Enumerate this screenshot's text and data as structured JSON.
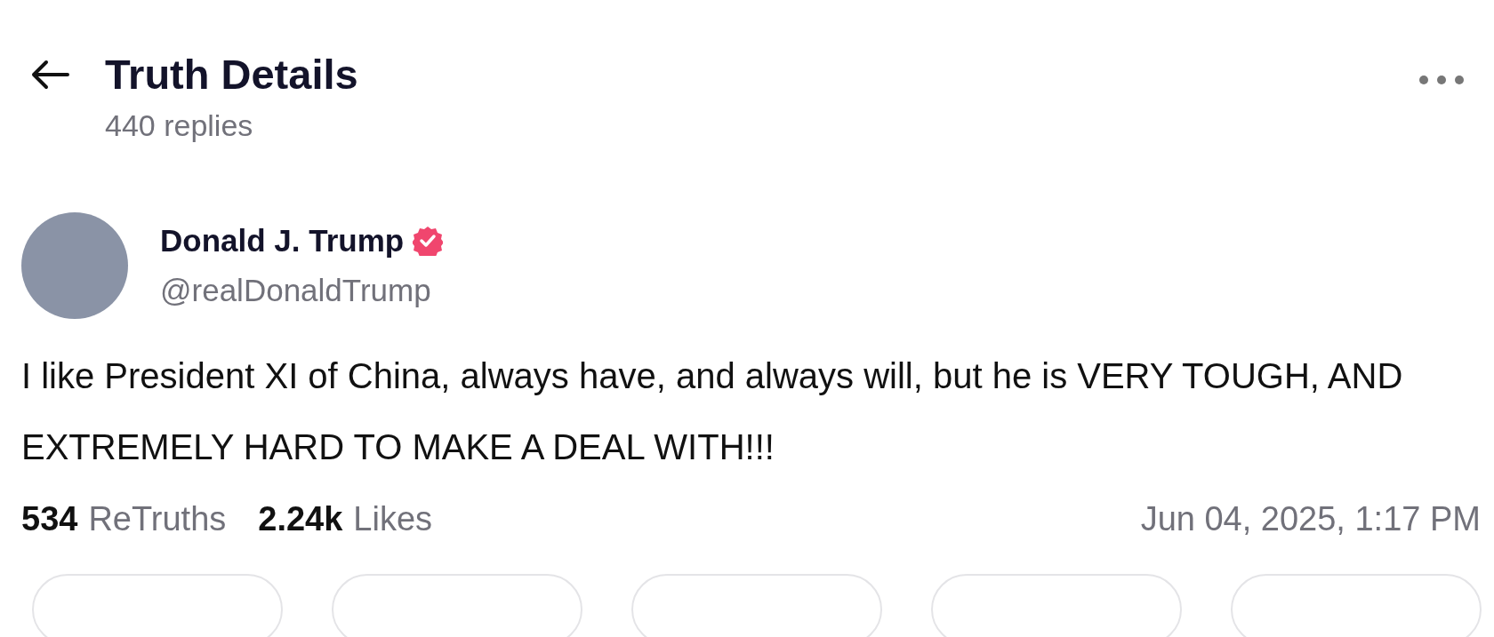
{
  "header": {
    "title": "Truth Details",
    "subtitle": "440 replies"
  },
  "post": {
    "author": {
      "name": "Donald J. Trump",
      "verified": true,
      "handle": "@realDonaldTrump"
    },
    "text": "I like President XI of China, always have, and always will, but he is VERY TOUGH, AND EXTREMELY HARD TO MAKE A DEAL WITH!!!",
    "stats": [
      {
        "count": "534",
        "label": "ReTruths"
      },
      {
        "count": "2.24k",
        "label": "Likes"
      }
    ],
    "timestamp": "Jun 04, 2025, 1:17 PM"
  }
}
